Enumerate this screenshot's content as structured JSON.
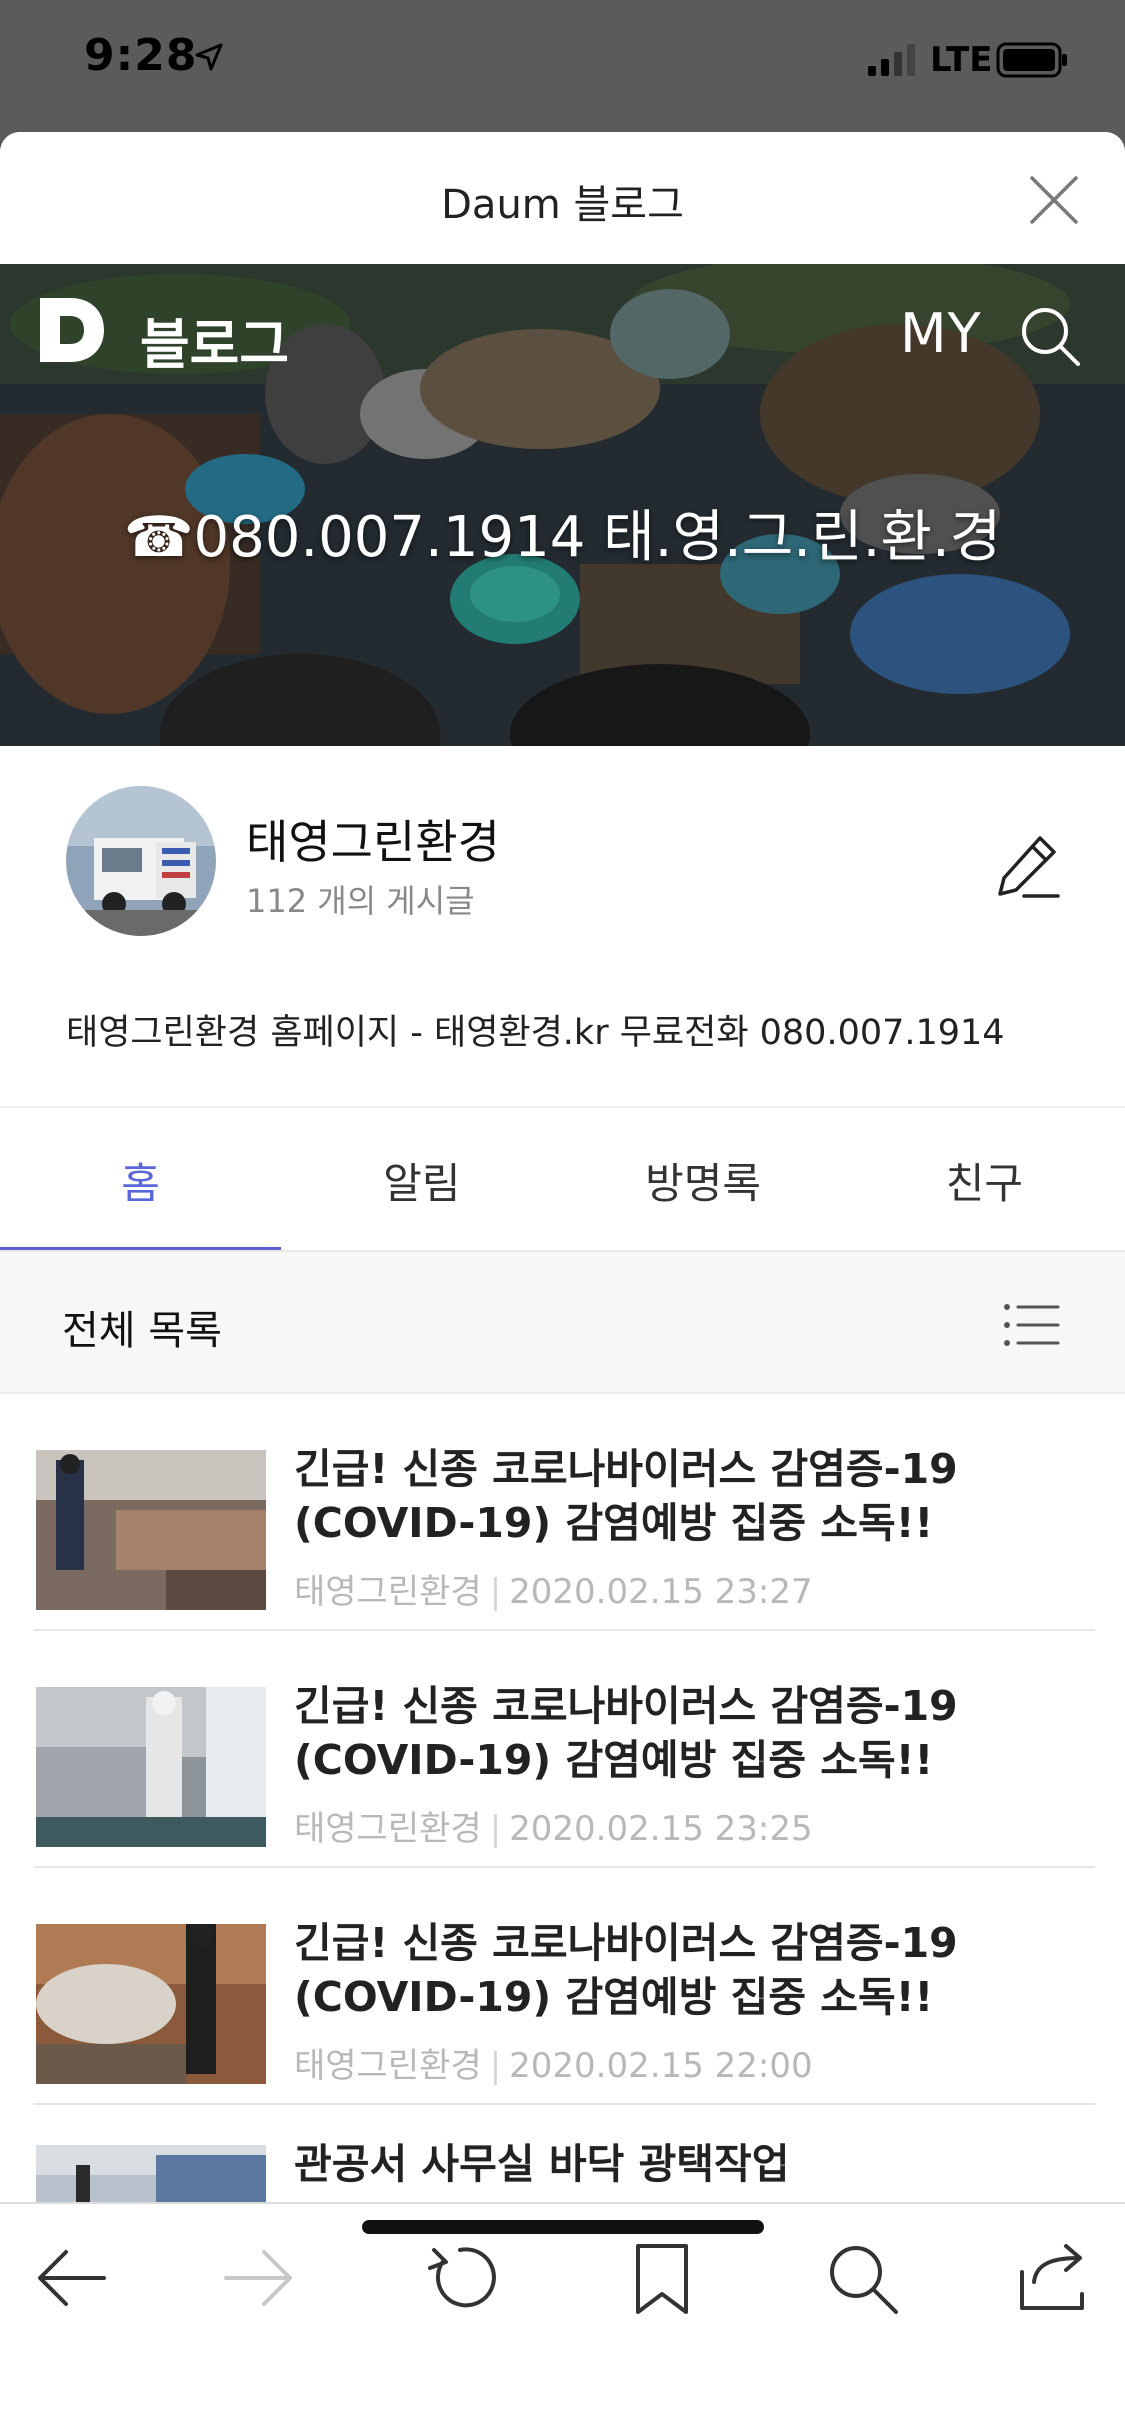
{
  "status_bar": {
    "time": "9:28",
    "network": "LTE"
  },
  "sheet": {
    "title": "Daum 블로그"
  },
  "banner": {
    "logo_label": "블로그",
    "my_label": "MY",
    "phone_text": "☎080.007.1914 태.영.그.린.환.경"
  },
  "profile": {
    "name": "태영그린환경",
    "post_count": "112 개의 게시글",
    "description": "태영그린환경 홈페이지 - 태영환경.kr 무료전화 080.007.1914"
  },
  "tabs": [
    {
      "label": "홈",
      "active": true
    },
    {
      "label": "알림",
      "active": false
    },
    {
      "label": "방명록",
      "active": false
    },
    {
      "label": "친구",
      "active": false
    }
  ],
  "list": {
    "header": "전체 목록",
    "posts": [
      {
        "title": "긴급! 신종 코로나바이러스 감염증-19 (COVID-19) 감염예방 집중 소독!!",
        "author": "태영그린환경",
        "date": "2020.02.15 23:27"
      },
      {
        "title": "긴급! 신종 코로나바이러스 감염증-19 (COVID-19) 감염예방 집중 소독!!",
        "author": "태영그린환경",
        "date": "2020.02.15 23:25"
      },
      {
        "title": "긴급! 신종 코로나바이러스 감염증-19 (COVID-19) 감염예방 집중 소독!!",
        "author": "태영그린환경",
        "date": "2020.02.15 22:00"
      },
      {
        "title": "관공서 사무실 바닥 광택작업",
        "author": "",
        "date": ""
      }
    ]
  },
  "toolbar": {
    "icons": [
      "back-arrow-icon",
      "forward-arrow-icon",
      "reload-icon",
      "bookmark-icon",
      "search-icon",
      "share-icon"
    ]
  },
  "colors": {
    "accent": "#5a5fcf",
    "meta_gray": "#b8b8b8"
  }
}
